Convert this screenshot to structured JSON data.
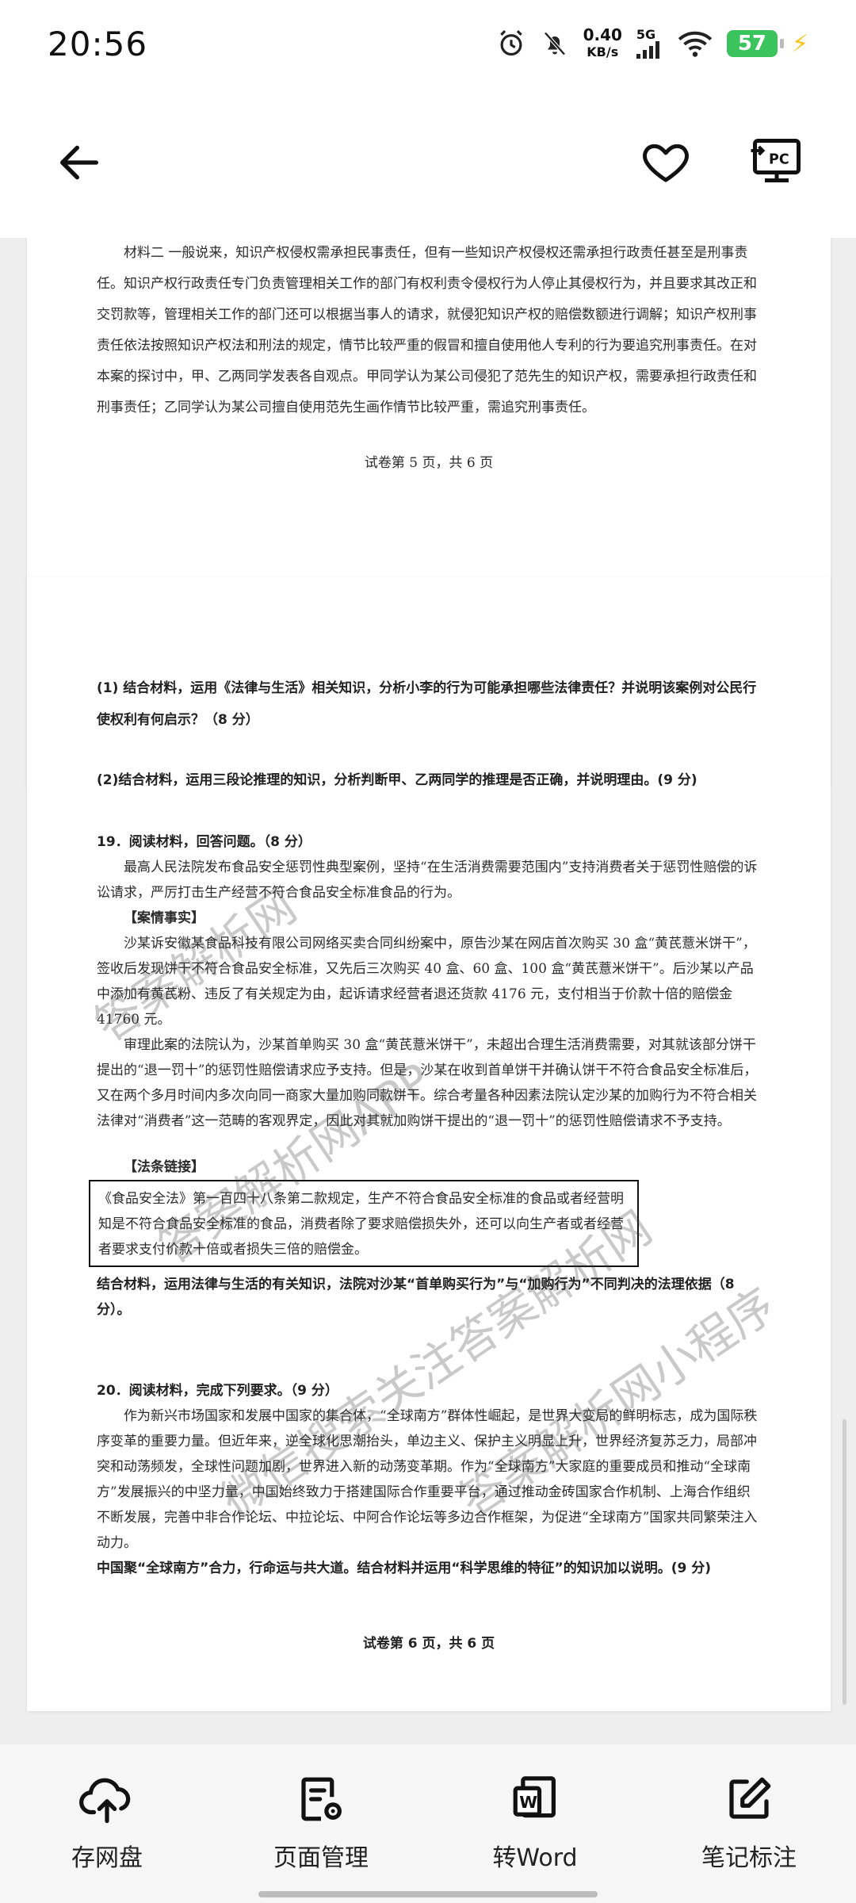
{
  "status_bar": {
    "time": "20:56",
    "net_speed_value": "0.40",
    "net_speed_unit": "KB/s",
    "network": "5G",
    "battery": "57"
  },
  "page1": {
    "paragraph": "材料二 一般说来，知识产权侵权需承担民事责任，但有一些知识产权侵权还需承担行政责任甚至是刑事责任。知识产权行政责任专门负责管理相关工作的部门有权利责令侵权行为人停止其侵权行为，并且要求其改正和交罚款等，管理相关工作的部门还可以根据当事人的请求，就侵犯知识产权的赔偿数额进行调解；知识产权刑事责任依法按照知识产权法和刑法的规定，情节比较严重的假冒和擅自使用他人专利的行为要追究刑事责任。在对本案的探讨中，甲、乙两同学发表各自观点。甲同学认为某公司侵犯了范先生的知识产权，需要承担行政责任和刑事责任；乙同学认为某公司擅自使用范先生画作情节比较严重，需追究刑事责任。",
    "footer": "试卷第 5 页，共 6 页"
  },
  "page2": {
    "q1": "(1) 结合材料，运用《法律与生活》相关知识，分析小李的行为可能承担哪些法律责任？并说明该案例对公民行使权利有何启示？（8 分）",
    "q2": "(2)结合材料，运用三段论推理的知识，分析判断甲、乙两同学的推理是否正确，并说明理由。(9 分)",
    "q19_title": "19．阅读材料，回答问题。（8 分）",
    "q19_intro": "最高人民法院发布食品安全惩罚性典型案例，坚持“在生活消费需要范围内”支持消费者关于惩罚性赔偿的诉讼请求，严厉打击生产经营不符合食品安全标准食品的行为。",
    "case_heading": "【案情事实】",
    "case_facts": "沙某诉安徽某食品科技有限公司网络买卖合同纠纷案中，原告沙某在网店首次购买 30 盒“黄芪薏米饼干”，签收后发现饼干不符合食品安全标准，又先后三次购买 40 盒、60 盒、100 盒“黄芪薏米饼干”。后沙某以产品中添加有黄芪粉、违反了有关规定为由，起诉请求经营者退还货款 4176 元，支付相当于价款十倍的赔偿金 41760 元。",
    "court_view": "审理此案的法院认为，沙某首单购买 30 盒“黄芪薏米饼干”，未超出合理生活消费需要，对其就该部分饼干提出的“退一罚十”的惩罚性赔偿请求应予支持。但是，沙某在收到首单饼干并确认饼干不符合食品安全标准后，又在两个多月时间内多次向同一商家大量加购同款饼干。综合考量各种因素法院认定沙某的加购行为不符合相关法律对“消费者”这一范畴的客观界定，因此对其就加购饼干提出的“退一罚十”的惩罚性赔偿请求不予支持。",
    "law_heading": "【法条链接】",
    "law_text": "《食品安全法》第一百四十八条第二款规定，生产不符合食品安全标准的食品或者经营明知是不符合食品安全标准的食品，消费者除了要求赔偿损失外，还可以向生产者或者经营者要求支付价款十倍或者损失三倍的赔偿金。",
    "q19_question": "结合材料，运用法律与生活的有关知识，法院对沙某“首单购买行为”与“加购行为”不同判决的法理依据（8 分）。",
    "q20_title": "20．阅读材料，完成下列要求。（9 分）",
    "q20_material": "作为新兴市场国家和发展中国家的集合体，“全球南方”群体性崛起，是世界大变局的鲜明标志，成为国际秩序变革的重要力量。但近年来，逆全球化思潮抬头，单边主义、保护主义明显上升，世界经济复苏乏力，局部冲突和动荡频发，全球性问题加剧，世界进入新的动荡变革期。作为“全球南方”大家庭的重要成员和推动“全球南方”发展振兴的中坚力量，中国始终致力于搭建国际合作重要平台，通过推动金砖国家合作机制、上海合作组织不断发展，完善中非合作论坛、中拉论坛、中阿合作论坛等多边合作框架，为促进“全球南方”国家共同繁荣注入动力。",
    "q20_question": "中国聚“全球南方”合力，行命运与共大道。结合材料并运用“科学思维的特征”的知识加以说明。(9 分)",
    "footer": "试卷第 6 页，共 6 页"
  },
  "watermarks": [
    "答案解析网",
    "答案解析网APP",
    "微信搜索关注答案解析网",
    "答案解析网小程序"
  ],
  "toolbar": {
    "items": [
      {
        "label": "存网盘",
        "icon": "cloud-upload-icon"
      },
      {
        "label": "页面管理",
        "icon": "page-settings-icon"
      },
      {
        "label": "转Word",
        "icon": "word-convert-icon"
      },
      {
        "label": "笔记标注",
        "icon": "edit-note-icon"
      }
    ]
  }
}
